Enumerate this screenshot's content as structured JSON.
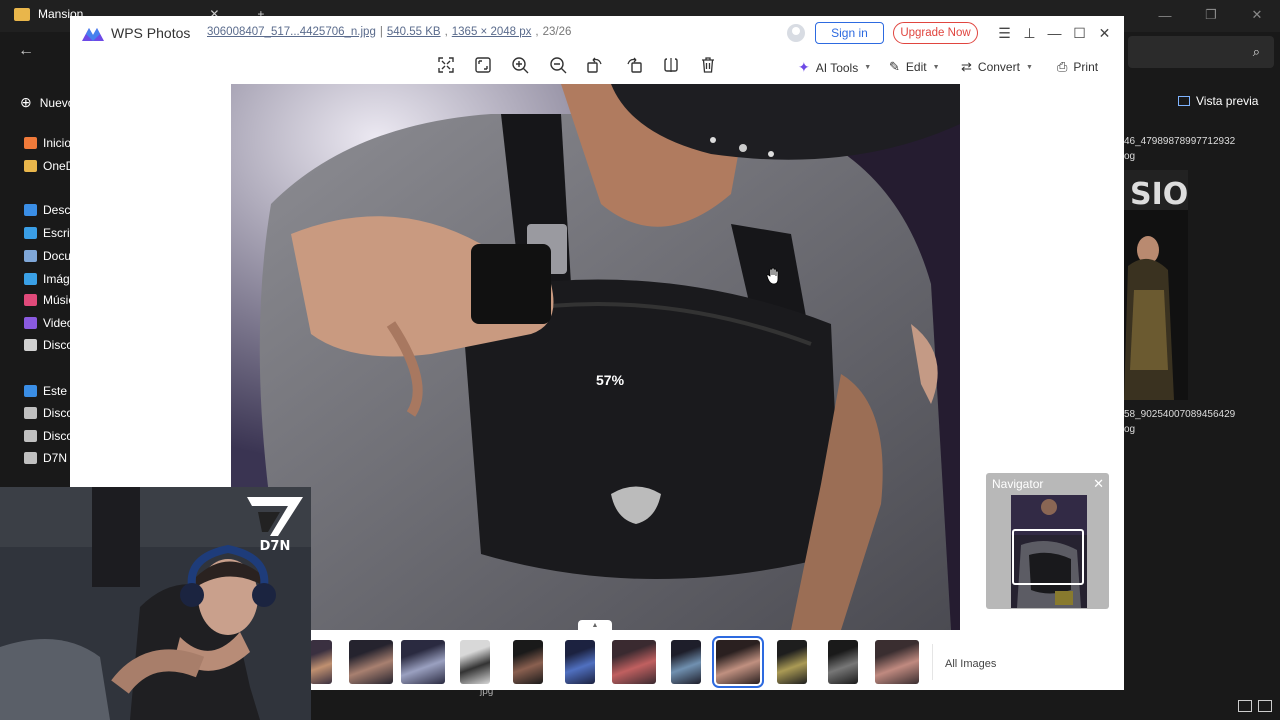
{
  "explorer": {
    "window_title": "Mansion",
    "sidebar": [
      {
        "label": "Inicio",
        "color": "#f07a3a"
      },
      {
        "label": "OneDrive",
        "color": "#e9b64b"
      },
      {
        "label": "Descargas",
        "color": "#3a8ee6"
      },
      {
        "label": "Escritorio",
        "color": "#3a9ee6"
      },
      {
        "label": "Documentos",
        "color": "#7fa7d8"
      },
      {
        "label": "Imágenes",
        "color": "#3aa0e6"
      },
      {
        "label": "Música",
        "color": "#e04a7a"
      },
      {
        "label": "Videos",
        "color": "#8a5ae0"
      },
      {
        "label": "Discord",
        "color": "#d0d0d0"
      },
      {
        "label": "Este equipo",
        "color": "#3a8ee6"
      },
      {
        "label": "Disco",
        "color": "#c0c0c0"
      },
      {
        "label": "Disco",
        "color": "#c0c0c0"
      },
      {
        "label": "D7N",
        "color": "#c0c0c0"
      }
    ],
    "new_label": "Nuevo",
    "preview_label": "Vista previa",
    "files": [
      {
        "name": "46_4798987899771293",
        "ext": "2"
      },
      {
        "name": "og",
        "ext": ""
      },
      {
        "name": "58_9025400708945642",
        "ext": "9"
      },
      {
        "name": "og",
        "ext": ""
      }
    ],
    "bottom_file": "jpg"
  },
  "wps": {
    "app_name": "WPS Photos",
    "file_name": "306008407_517...4425706_n.jpg",
    "file_size": "540.55 KB",
    "dimensions": "1365 × 2048 px",
    "position": "23/26",
    "signin_label": "Sign in",
    "upgrade_label": "Upgrade Now",
    "toolbar": {
      "icons": [
        "fit-to-screen-icon",
        "actual-size-icon",
        "zoom-in-icon",
        "zoom-out-icon",
        "rotate-left-icon",
        "rotate-right-icon",
        "flip-icon",
        "delete-icon"
      ],
      "ai_tools_label": "AI Tools",
      "edit_label": "Edit",
      "convert_label": "Convert",
      "print_label": "Print"
    },
    "zoom": "57%",
    "navigator_title": "Navigator",
    "all_images_label": "All Images",
    "filmstrip_count": 12,
    "filmstrip_active_index": 8
  },
  "webcam": {
    "logo_text": "D7N"
  }
}
